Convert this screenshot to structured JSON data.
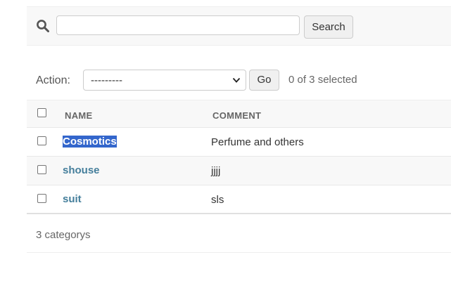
{
  "search": {
    "value": "",
    "placeholder": "",
    "button_label": "Search",
    "icon": "search-icon"
  },
  "actions": {
    "label": "Action:",
    "selected_option": "---------",
    "go_label": "Go",
    "selection_status": "0 of 3 selected"
  },
  "table": {
    "columns": [
      "NAME",
      "COMMENT"
    ],
    "rows": [
      {
        "name": "Cosmotics",
        "comment": "Perfume and others",
        "highlighted": true
      },
      {
        "name": "shouse",
        "comment": "jjjj",
        "highlighted": false
      },
      {
        "name": "suit",
        "comment": "sls",
        "highlighted": false
      }
    ]
  },
  "footer": {
    "count_text": "3 categorys"
  },
  "colors": {
    "link": "#447e9b",
    "selection_highlight": "#3366cc",
    "header_bg": "#f8f8f8"
  }
}
